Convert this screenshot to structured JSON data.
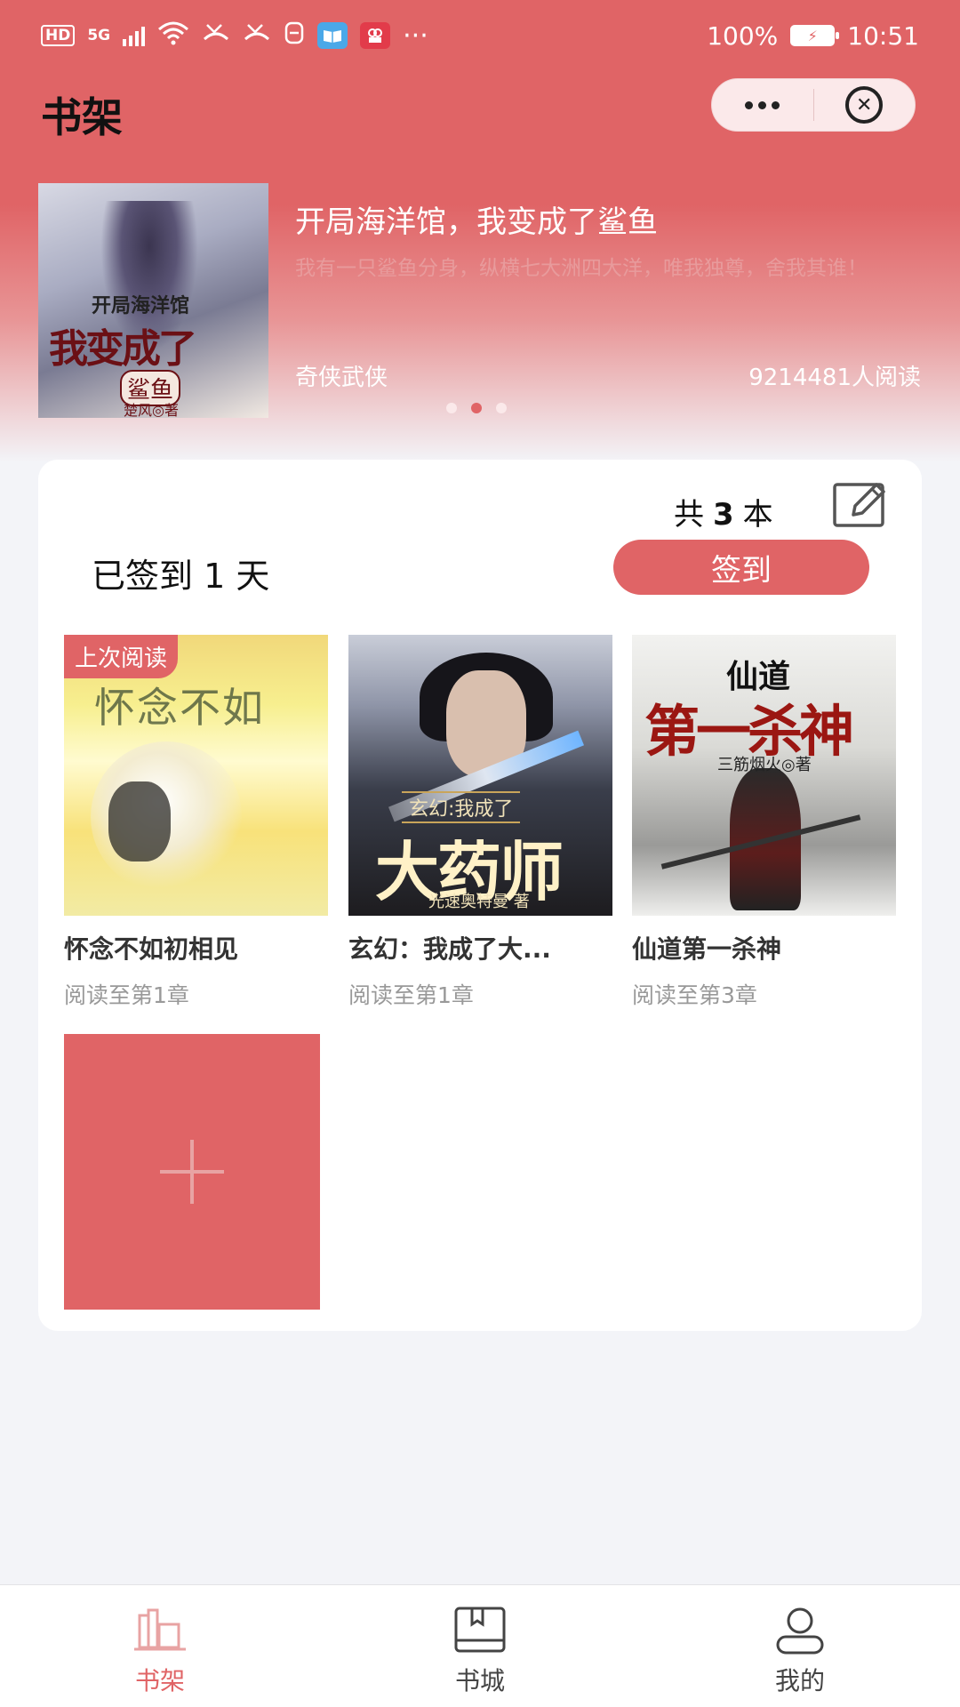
{
  "status_bar": {
    "left_icons": [
      "HD",
      "5G",
      "signal-icon",
      "wifi-icon",
      "missed-call-icon",
      "missed-call-icon",
      "sim-icon",
      "reader-app-icon",
      "video-app-icon"
    ],
    "hd": "HD",
    "net": "5G",
    "more": "···",
    "battery": "100%",
    "time": "10:51"
  },
  "nav": {
    "title": "书架",
    "capsule_more": "···",
    "capsule_close": "⊗"
  },
  "banner": {
    "title": "开局海洋馆，我变成了鲨鱼",
    "description": "我有一只鲨鱼分身，纵横七大洲四大洋，唯我独尊，舍我其谁！",
    "genre": "奇侠武侠",
    "readers": "9214481人阅读",
    "cover": {
      "line1": "开局海洋馆",
      "line2": "我变成了",
      "line3": "鲨鱼",
      "author": "楚风◎著"
    },
    "pager": {
      "count": 3,
      "active_index": 1
    }
  },
  "shelf": {
    "count_prefix": "共",
    "count_value": "3",
    "count_suffix": "本",
    "signin_text": "已签到 1 天",
    "signin_button": "签到",
    "last_read_badge": "上次阅读",
    "books": [
      {
        "title": "怀念不如初相见",
        "progress": "阅读至第1章",
        "cover_title": "怀念不如",
        "last_read": true
      },
      {
        "title": "玄幻：我成了大...",
        "progress": "阅读至第1章",
        "cover_sub": "玄幻:我成了",
        "cover_title": "大药师",
        "cover_author": "光速奥特曼 著"
      },
      {
        "title": "仙道第一杀神",
        "progress": "阅读至第3章",
        "cover_top": "仙道",
        "cover_title": "第一杀神",
        "cover_author": "三筋烟火◎著"
      }
    ],
    "add_tile_icon": "plus-icon"
  },
  "tab_bar": {
    "tabs": [
      {
        "label": "书架",
        "icon": "bookshelf-icon",
        "active": true
      },
      {
        "label": "书城",
        "icon": "book-store-icon",
        "active": false
      },
      {
        "label": "我的",
        "icon": "profile-icon",
        "active": false
      }
    ]
  },
  "colors": {
    "accent": "#e06466",
    "background": "#f3f4f8",
    "card": "#ffffff"
  }
}
